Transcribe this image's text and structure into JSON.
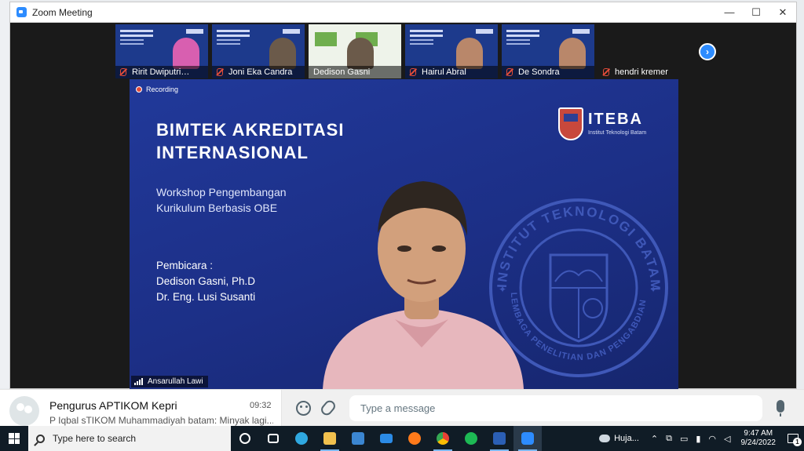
{
  "window": {
    "title": "Zoom Meeting",
    "controls": [
      "—",
      "☐",
      "✕"
    ]
  },
  "participants": [
    {
      "name": "Ririt Dwiputri…",
      "muted": true
    },
    {
      "name": "Joni Eka Candra",
      "muted": true
    },
    {
      "name": "Dedison Gasni",
      "muted": false
    },
    {
      "name": "Hairul Abral",
      "muted": true
    },
    {
      "name": "De Sondra",
      "muted": true
    },
    {
      "name": "hendri kremer",
      "muted": true
    }
  ],
  "next_page_glyph": "›",
  "recording": {
    "label": "Recording"
  },
  "slide": {
    "title_line1": "BIMTEK AKREDITASI",
    "title_line2": "INTERNASIONAL",
    "subtitle_line1": "Workshop Pengembangan",
    "subtitle_line2": "Kurikulum Berbasis OBE",
    "speakers_heading": "Pembicara :",
    "speaker1": "Dedison Gasni, Ph.D",
    "speaker2": "Dr. Eng. Lusi Susanti",
    "brand_word": "ITEBA",
    "brand_tagline": "Institut Teknologi Batam",
    "seal_text_top": "INSTITUT TEKNOLOGI BATAM",
    "seal_text_bottom": "LEMBAGA PENELITIAN DAN PENGABDIAN MASYARAKAT"
  },
  "active_speaker": {
    "name": "Ansarullah Lawi"
  },
  "chat": {
    "group_name": "Pengurus APTIKOM Kepri",
    "time": "09:32",
    "last_message": "P Iqbal sTIKOM Muhammadiyah batam: Minyak lagi...",
    "composer_placeholder": "Type a message"
  },
  "taskbar": {
    "search_placeholder": "Type here to search",
    "weather": "Huja...",
    "time": "9:47 AM",
    "date": "9/24/2022",
    "notification_count": "1",
    "apps": [
      {
        "name": "cortana",
        "color": "#ffffff"
      },
      {
        "name": "task-view",
        "color": "#ffffff"
      },
      {
        "name": "edge",
        "color": "#2fa8e0"
      },
      {
        "name": "file-explorer",
        "color": "#f2c14e"
      },
      {
        "name": "store",
        "color": "#3b86d1"
      },
      {
        "name": "mail",
        "color": "#2b8be6"
      },
      {
        "name": "firefox",
        "color": "#ff7a1a"
      },
      {
        "name": "chrome",
        "color": "#2fae55"
      },
      {
        "name": "spotify",
        "color": "#1db954"
      },
      {
        "name": "word",
        "color": "#2b5fb5"
      },
      {
        "name": "zoom",
        "color": "#2d8cff"
      }
    ]
  }
}
